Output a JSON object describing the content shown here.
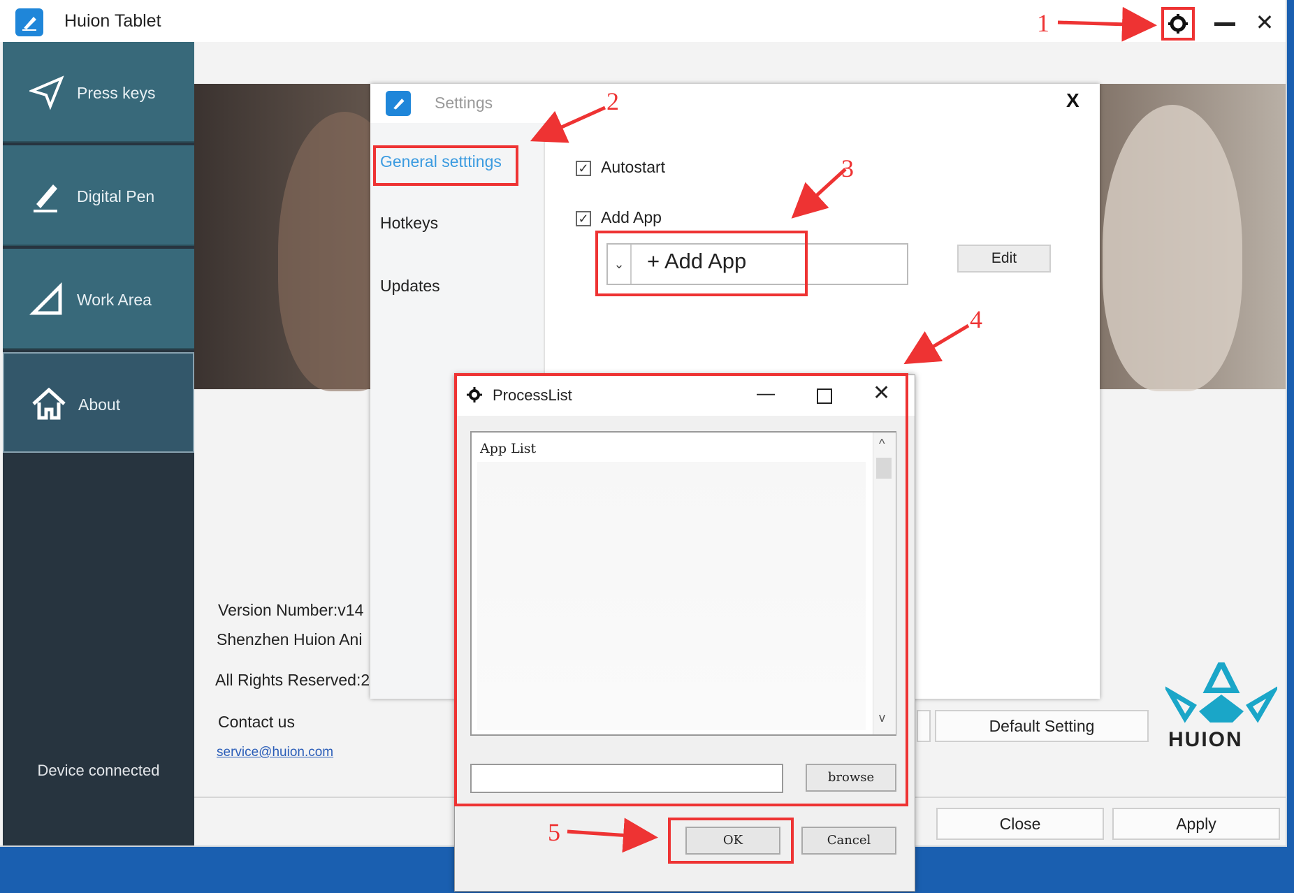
{
  "window": {
    "title": "Huion Tablet",
    "close_glyph": "✕"
  },
  "sidebar": {
    "items": [
      {
        "label": "Press keys",
        "icon": "send-icon"
      },
      {
        "label": "Digital Pen",
        "icon": "pen-icon"
      },
      {
        "label": "Work Area",
        "icon": "triangle-icon"
      },
      {
        "label": "About",
        "icon": "home-icon"
      }
    ],
    "active": "About",
    "status": "Device connected"
  },
  "about": {
    "version": "Version Number:v14",
    "company": "Shenzhen Huion Ani",
    "rights": "All Rights Reserved:2",
    "contact_label": "Contact us",
    "contact_email": "service@huion.com",
    "brand": "HUION"
  },
  "main_buttons": {
    "default_setting": "Default Setting",
    "close": "Close",
    "apply": "Apply"
  },
  "settings": {
    "title": "Settings",
    "close_glyph": "X",
    "nav": [
      "General setttings",
      "Hotkeys",
      "Updates"
    ],
    "autostart_label": "Autostart",
    "autostart_checked": true,
    "add_app_label": "Add App",
    "add_app_checked": true,
    "combo_text": "+ Add App",
    "combo_drop": "⌄",
    "edit_button": "Edit"
  },
  "process_list": {
    "title": "ProcessList",
    "list_header": "App List",
    "browse_button": "browse",
    "ok_button": "OK",
    "cancel_button": "Cancel",
    "scroll_up": "^",
    "scroll_down": "v",
    "min_glyph": "—",
    "close_glyph": "✕"
  },
  "annotations": {
    "steps": [
      "1",
      "2",
      "3",
      "4",
      "5"
    ],
    "color": "#e33333"
  }
}
